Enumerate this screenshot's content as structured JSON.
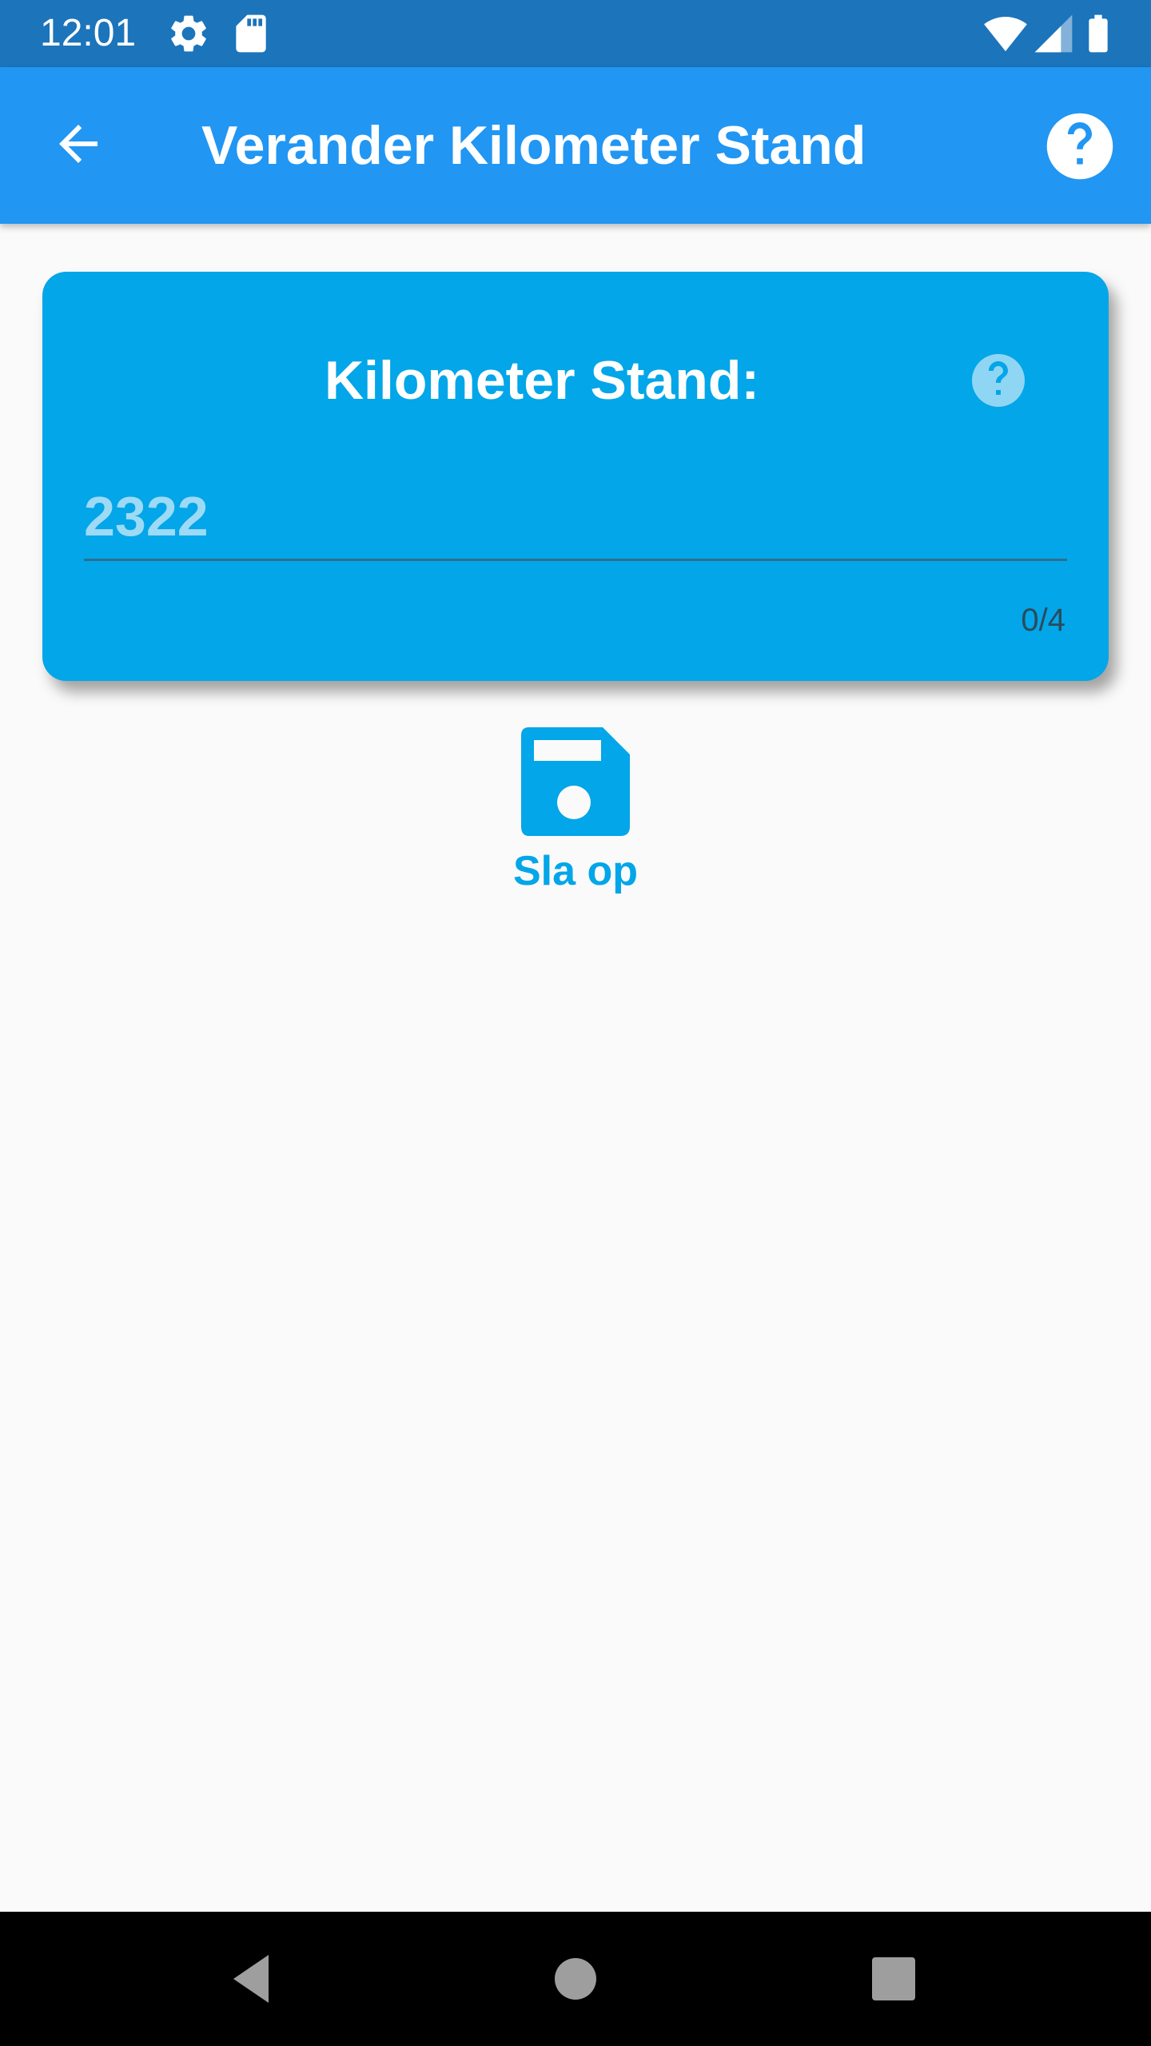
{
  "status_bar": {
    "time": "12:01",
    "icons": [
      "settings-icon",
      "sd-card-icon",
      "wifi-icon",
      "signal-icon",
      "battery-icon"
    ]
  },
  "app_bar": {
    "title": "Verander Kilometer Stand",
    "back_icon": "arrow-back-icon",
    "help_icon": "help-icon"
  },
  "card": {
    "title": "Kilometer Stand:",
    "help_icon": "help-icon",
    "input_placeholder": "2322",
    "input_value": "",
    "counter": "0/4"
  },
  "save_button": {
    "label": "Sla op",
    "icon": "floppy-disk-icon"
  },
  "nav_bar": {
    "icons": [
      "back-triangle-icon",
      "home-circle-icon",
      "recents-square-icon"
    ]
  },
  "colors": {
    "status_bar": "#1c74bb",
    "app_bar": "#2196f3",
    "card": "#03a6e8",
    "background": "#fafafa",
    "accent": "#03a6e8"
  }
}
